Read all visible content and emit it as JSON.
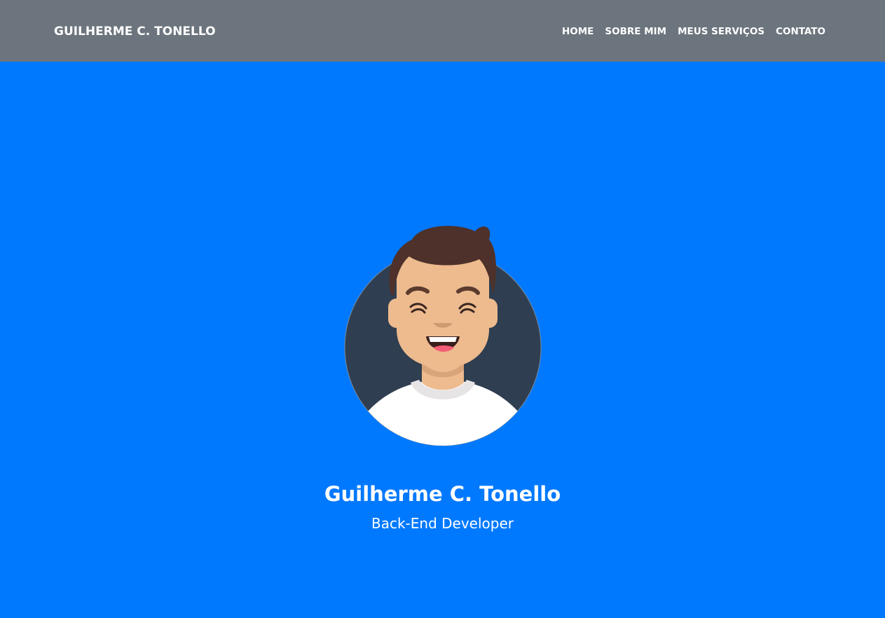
{
  "navbar": {
    "brand": "GUILHERME C. TONELLO",
    "links": [
      "HOME",
      "SOBRE MIM",
      "MEUS SERVIÇOS",
      "CONTATO"
    ]
  },
  "hero": {
    "name": "Guilherme C. Tonello",
    "role": "Back-End Developer",
    "avatar_icon": "smiling-man-avatar"
  },
  "colors": {
    "navbar_bg": "#6c757d",
    "hero_bg": "#0079ff",
    "avatar_bg": "#2f3e50",
    "text": "#ffffff"
  }
}
